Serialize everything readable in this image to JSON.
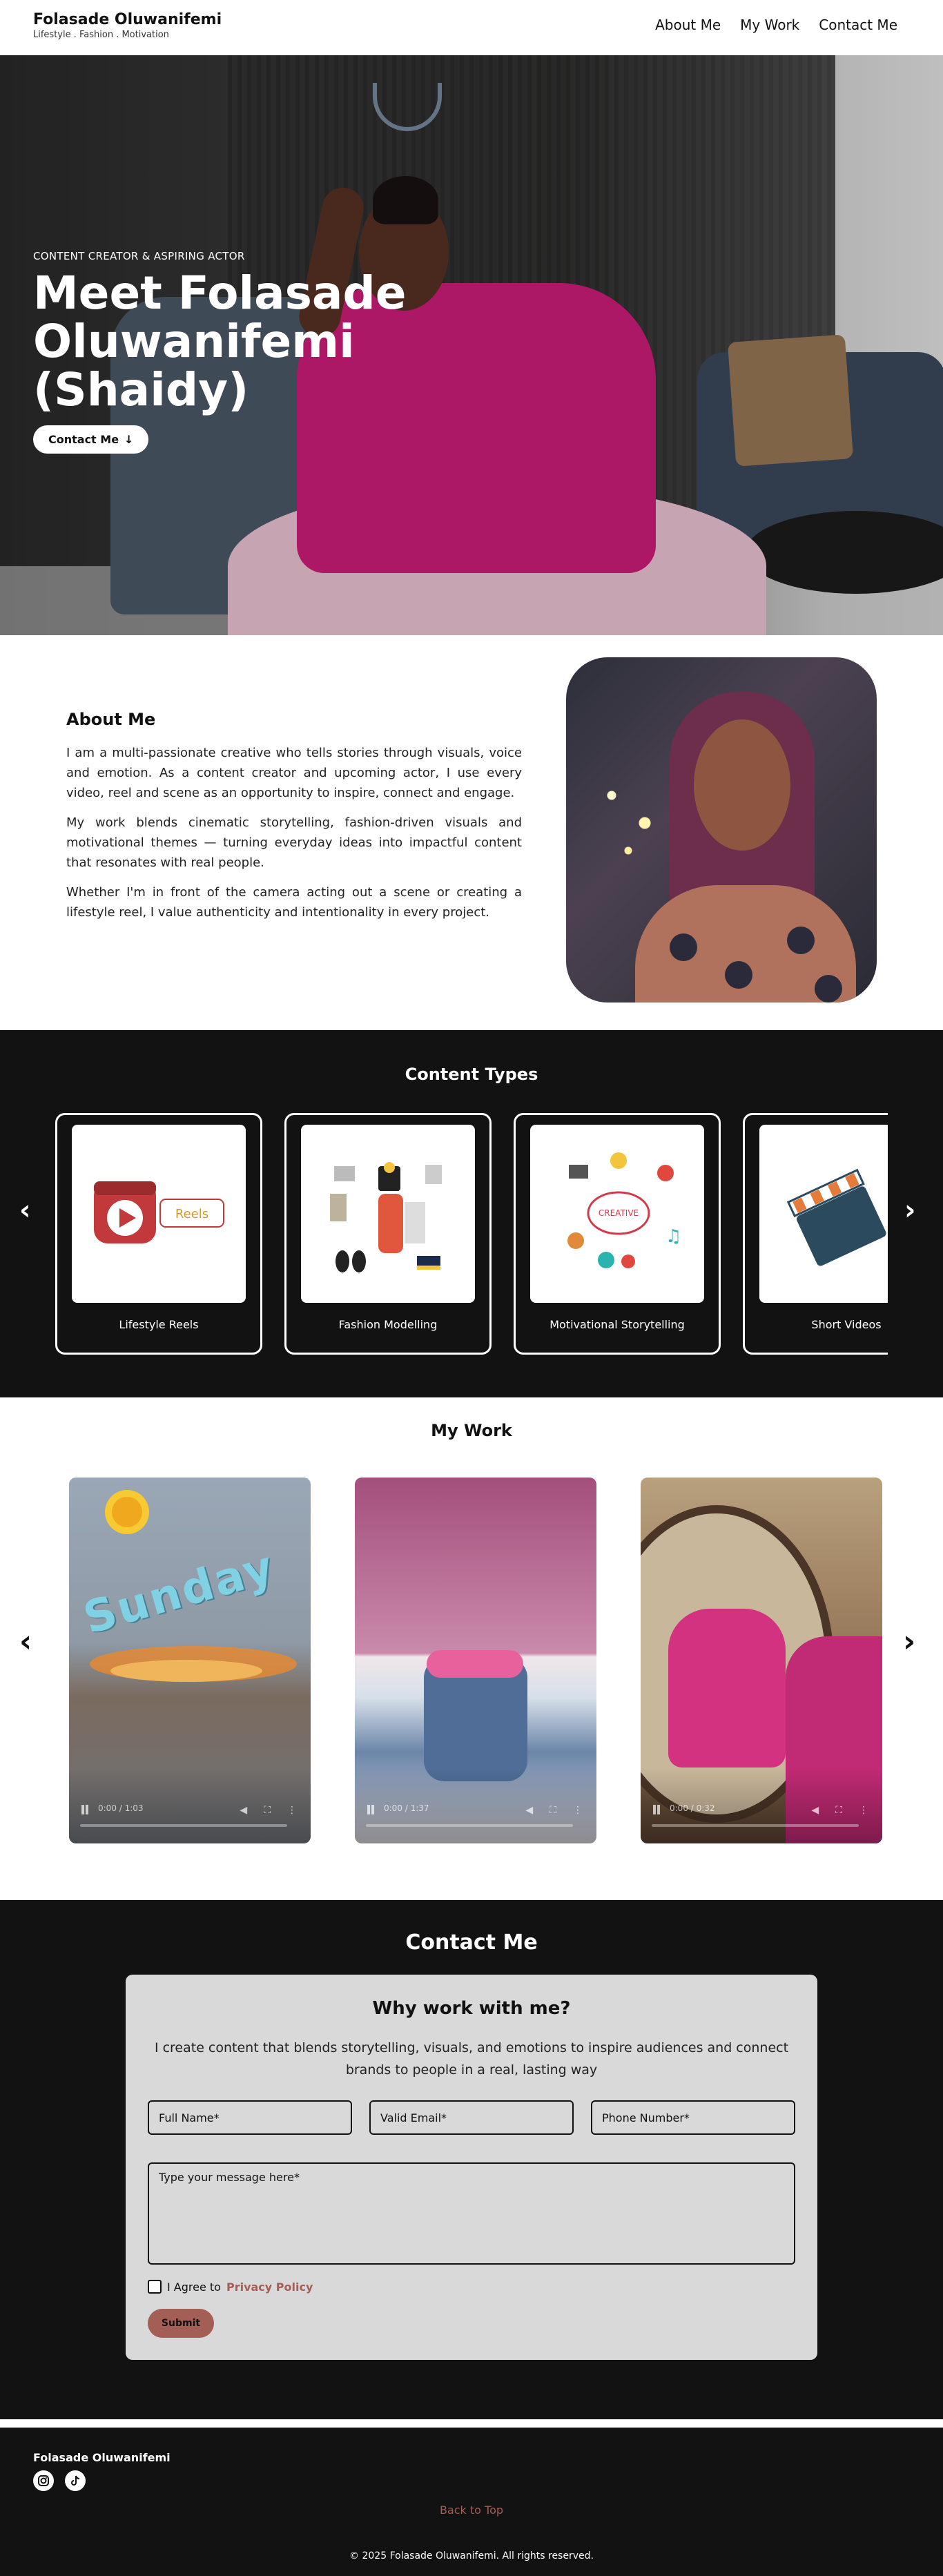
{
  "header": {
    "brand_name": "Folasade Oluwanifemi",
    "brand_tagline": "Lifestyle . Fashion . Motivation",
    "nav": [
      "About Me",
      "My Work",
      "Contact Me"
    ]
  },
  "hero": {
    "kicker": "CONTENT CREATOR & ASPIRING ACTOR",
    "title": "Meet Folasade Oluwanifemi (Shaidy)",
    "button_label": "Contact Me"
  },
  "about": {
    "heading": "About Me",
    "paragraphs": [
      "I am a multi-passionate creative who tells stories through visuals, voice and emotion. As a content creator and upcoming actor, I use every video, reel and scene as an opportunity to inspire, connect and engage.",
      "My work blends cinematic storytelling, fashion-driven visuals and motivational themes — turning everyday ideas into impactful content that resonates with real people.",
      "Whether I'm in front of the camera acting out a scene or creating a lifestyle reel, I value authenticity and intentionality in every project."
    ]
  },
  "content_types": {
    "heading": "Content Types",
    "cards": [
      {
        "label": "Lifestyle Reels",
        "icon": "reels-icon",
        "badge": "Reels"
      },
      {
        "label": "Fashion Modelling",
        "icon": "fashion-items-icon"
      },
      {
        "label": "Motivational Storytelling",
        "icon": "creative-brain-icon",
        "badge": "CREATIVE"
      },
      {
        "label": "Short Videos",
        "icon": "clapperboard-icon"
      }
    ]
  },
  "my_work": {
    "heading": "My Work",
    "videos": [
      {
        "time": "0:00 / 1:03",
        "overlay_text": "Sunday"
      },
      {
        "time": "0:00 / 1:37"
      },
      {
        "time": "0:00 / 0:32"
      }
    ]
  },
  "contact": {
    "heading": "Contact Me",
    "card_title": "Why work with me?",
    "intro": "I create content that blends storytelling, visuals, and emotions to inspire audiences and connect brands to people in a real, lasting way",
    "placeholders": {
      "name": "Full Name*",
      "email": "Valid Email*",
      "phone": "Phone Number*",
      "message": "Type your message here*"
    },
    "agree_text": "I Agree to",
    "policy_link": "Privacy Policy",
    "submit_label": "Submit"
  },
  "footer": {
    "name": "Folasade Oluwanifemi",
    "socials": [
      "instagram-icon",
      "tiktok-icon"
    ],
    "back_to_top": "Back to Top",
    "copyright": "© 2025 Folasade Oluwanifemi. All rights reserved."
  },
  "colors": {
    "accent": "#a35e55",
    "dark": "#121212",
    "card_bg": "#d9d9d9"
  }
}
